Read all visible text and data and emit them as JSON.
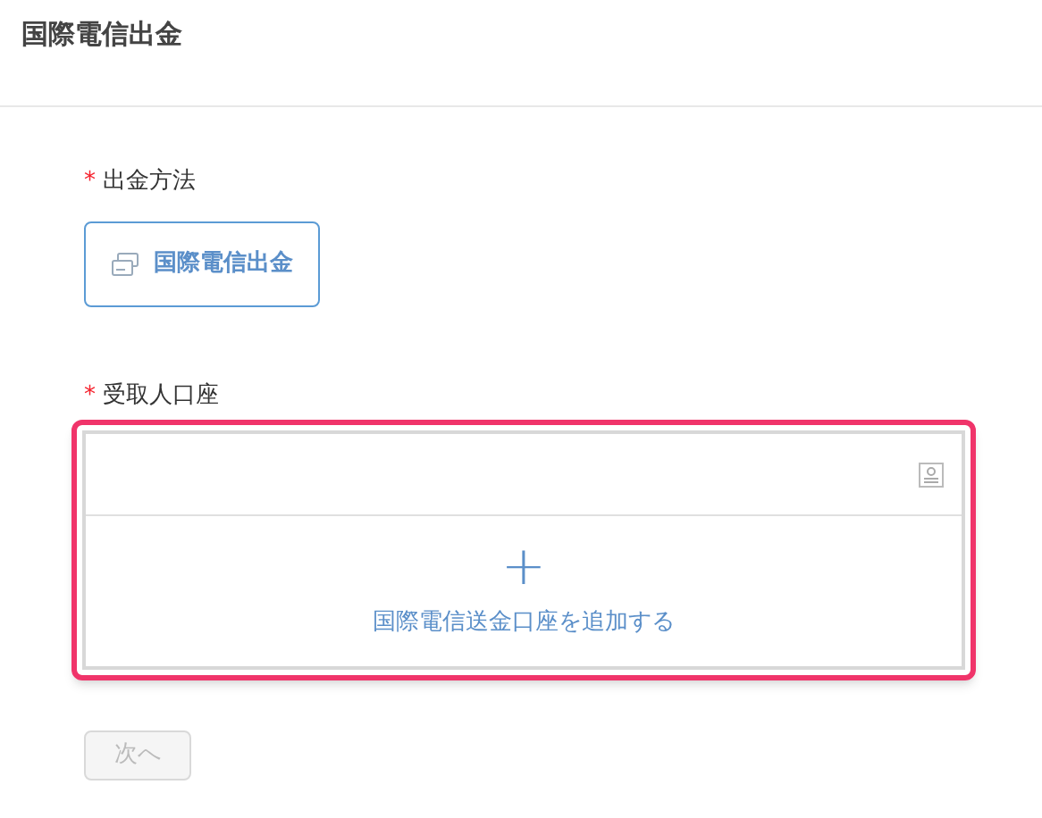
{
  "title": "国際電信出金",
  "method": {
    "label": "出金方法",
    "required_mark": "*",
    "options": [
      {
        "label": "国際電信出金",
        "selected": true
      }
    ]
  },
  "account": {
    "label": "受取人口座",
    "required_mark": "*",
    "highlighted": true,
    "add_plus": "+",
    "add_text": "国際電信送金口座を追加する"
  },
  "next_button": {
    "label": "次へ",
    "disabled": true
  }
}
